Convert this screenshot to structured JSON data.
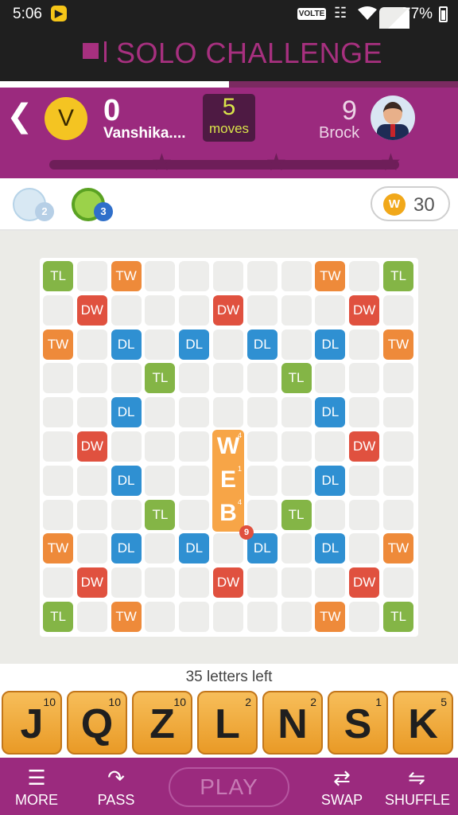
{
  "status_bar": {
    "time": "5:06",
    "notification_icon": "play-store-icon",
    "volte": "VOLTE",
    "battery_percent": "77%"
  },
  "header": {
    "title": "SOLO CHALLENGE",
    "progress_fraction": 0.5
  },
  "player1": {
    "avatar_letter": "V",
    "score": "0",
    "name": "Vanshika...."
  },
  "moves": {
    "count": "5",
    "label": "moves"
  },
  "player2": {
    "score": "9",
    "name": "Brock"
  },
  "powerups": {
    "item1_badge": "2",
    "item2_badge": "3",
    "coin_symbol": "W",
    "coins": "30"
  },
  "board": {
    "played_word": [
      {
        "letter": "W",
        "points": "4"
      },
      {
        "letter": "E",
        "points": "1"
      },
      {
        "letter": "B",
        "points": "4"
      }
    ],
    "word_score": "9",
    "labels": {
      "tl": "TL",
      "tw": "TW",
      "dw": "DW",
      "dl": "DL"
    }
  },
  "rack": {
    "letters_left": "35 letters left",
    "tiles": [
      {
        "letter": "J",
        "points": "10"
      },
      {
        "letter": "Q",
        "points": "10"
      },
      {
        "letter": "Z",
        "points": "10"
      },
      {
        "letter": "L",
        "points": "2"
      },
      {
        "letter": "N",
        "points": "2"
      },
      {
        "letter": "S",
        "points": "1"
      },
      {
        "letter": "K",
        "points": "5"
      }
    ]
  },
  "toolbar": {
    "more": "MORE",
    "pass": "PASS",
    "play": "PLAY",
    "swap": "SWAP",
    "shuffle": "SHUFFLE"
  }
}
